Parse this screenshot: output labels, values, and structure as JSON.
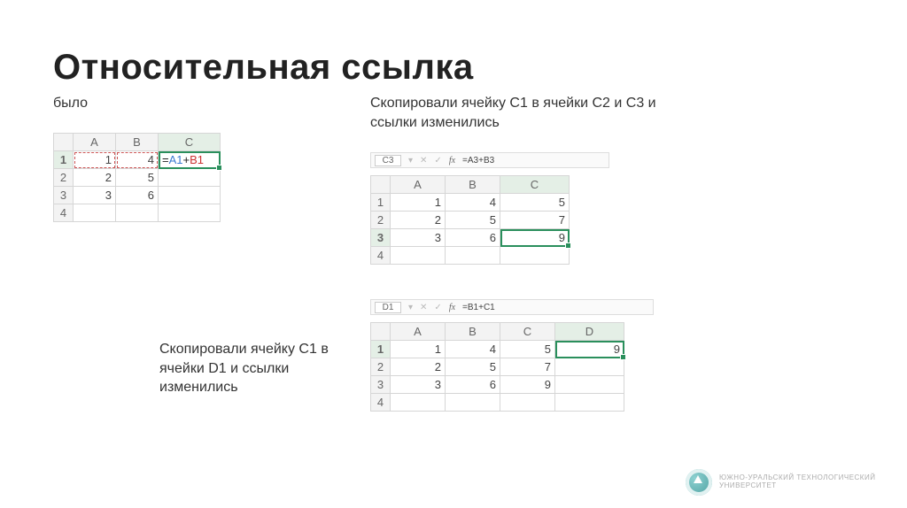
{
  "title": "Относительная ссылка",
  "sub_left": "было",
  "sub_right": "Скопировали ячейку С1 в ячейки С2 и С3 и ссылки изменились",
  "sub_bottom": "Скопировали ячейку С1 в ячейки D1 и ссылки изменились",
  "grid1": {
    "cols": [
      "A",
      "B",
      "C"
    ],
    "rows": [
      "1",
      "2",
      "3",
      "4"
    ],
    "cells": {
      "A1": "1",
      "B1": "4",
      "C1": "=A1+B1",
      "A2": "2",
      "B2": "5",
      "A3": "3",
      "B3": "6"
    },
    "formula_parts": {
      "eq": "=",
      "a": "A1",
      "plus": "+",
      "b": "B1"
    },
    "selected_col": "C",
    "selected_row": "1"
  },
  "grid2": {
    "fbar_name": "C3",
    "fbar_formula": "=A3+B3",
    "cols": [
      "A",
      "B",
      "C"
    ],
    "rows": [
      "1",
      "2",
      "3",
      "4"
    ],
    "cells": {
      "A1": "1",
      "B1": "4",
      "C1": "5",
      "A2": "2",
      "B2": "5",
      "C2": "7",
      "A3": "3",
      "B3": "6",
      "C3": "9"
    },
    "selected_col": "C",
    "selected_row": "3"
  },
  "grid3": {
    "fbar_name": "D1",
    "fbar_formula": "=B1+C1",
    "cols": [
      "A",
      "B",
      "C",
      "D"
    ],
    "rows": [
      "1",
      "2",
      "3",
      "4"
    ],
    "cells": {
      "A1": "1",
      "B1": "4",
      "C1": "5",
      "D1": "9",
      "A2": "2",
      "B2": "5",
      "C2": "7",
      "A3": "3",
      "B3": "6",
      "C3": "9"
    },
    "selected_col": "D",
    "selected_row": "1"
  },
  "footer": "ЮЖНО-УРАЛЬСКИЙ ТЕХНОЛОГИЧЕСКИЙ УНИВЕРСИТЕТ",
  "fbar_icons": {
    "dd": "▾",
    "x": "✕",
    "chk": "✓",
    "fx": "fx"
  }
}
